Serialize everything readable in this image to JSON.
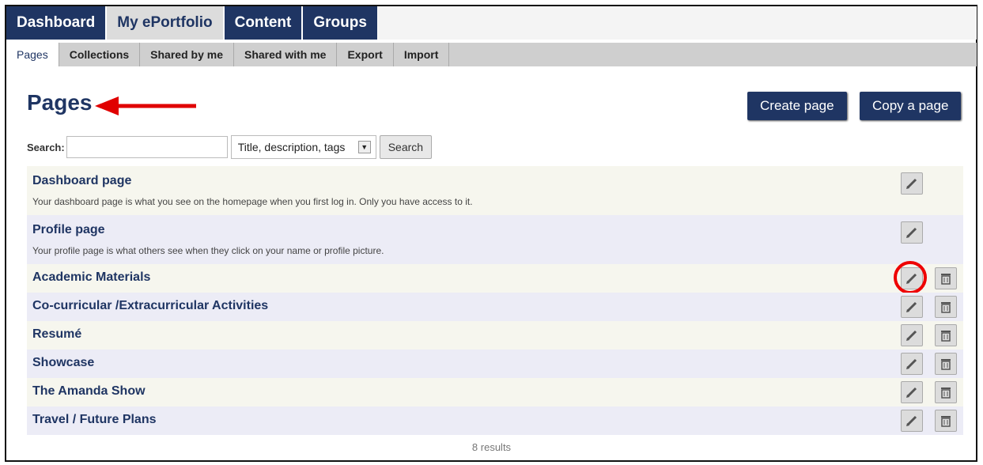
{
  "main_tabs": [
    "Dashboard",
    "My ePortfolio",
    "Content",
    "Groups"
  ],
  "sub_tabs": [
    "Pages",
    "Collections",
    "Shared by me",
    "Shared with me",
    "Export",
    "Import"
  ],
  "page_title": "Pages",
  "buttons": {
    "create_page": "Create page",
    "copy_page": "Copy a page",
    "search": "Search"
  },
  "search": {
    "label": "Search:",
    "value": "",
    "scope": "Title, description, tags"
  },
  "pages": [
    {
      "title": "Dashboard page",
      "description": "Your dashboard page is what you see on the homepage when you first log in. Only you have access to it."
    },
    {
      "title": "Profile page",
      "description": "Your profile page is what others see when they click on your name or profile picture."
    },
    {
      "title": "Academic Materials",
      "description": ""
    },
    {
      "title": "Co-curricular /Extracurricular Activities",
      "description": ""
    },
    {
      "title": "Resumé",
      "description": ""
    },
    {
      "title": "Showcase",
      "description": ""
    },
    {
      "title": "The Amanda Show",
      "description": ""
    },
    {
      "title": "Travel / Future Plans",
      "description": ""
    }
  ],
  "results_text": "8 results",
  "colors": {
    "nav": "#1f3563",
    "annotation": "#e00000"
  }
}
